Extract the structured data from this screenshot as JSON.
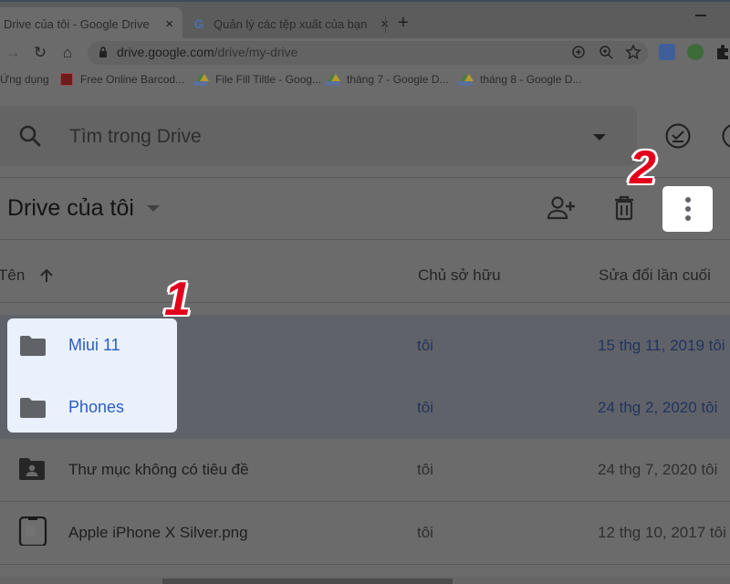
{
  "browser": {
    "tabs": [
      {
        "title": "Drive của tôi - Google Drive",
        "active": true,
        "close_glyph": "×"
      },
      {
        "title": "Quản lý các tệp xuất của bạn",
        "active": false,
        "favicon": "G",
        "close_glyph": "×"
      }
    ],
    "new_tab_glyph": "+",
    "url_host": "drive.google.com",
    "url_path": "/drive/my-drive",
    "nav_icons": {
      "forward": "→",
      "reload": "↻",
      "home": "⌂"
    },
    "omnibox_icons": [
      "install-icon",
      "zoom-icon",
      "bookmark-star-icon"
    ],
    "extensions": [
      "translate-icon",
      "idm-icon",
      "puzzle-extensions-icon"
    ],
    "bookmarks": [
      {
        "label": "Ứng dụng",
        "icon": "apps-icon"
      },
      {
        "label": "Free Online Barcod...",
        "icon": "barcode-favicon"
      },
      {
        "label": "File Fill Tiltle - Goog...",
        "icon": "drive-favicon"
      },
      {
        "label": "tháng 7 - Google D...",
        "icon": "drive-favicon"
      },
      {
        "label": "tháng 8 - Google D...",
        "icon": "drive-favicon"
      }
    ]
  },
  "drive": {
    "search": {
      "placeholder": "Tìm trong Drive",
      "value": ""
    },
    "title": "Drive của tôi",
    "actions": {
      "share": "add-person-icon",
      "delete": "trash-icon",
      "more": "more-vert-icon"
    },
    "columns": {
      "name": "Tên",
      "owner": "Chủ sở hữu",
      "modified": "Sửa đổi lần cuối"
    },
    "files": [
      {
        "name": "Miui 11",
        "type": "folder",
        "owner": "tôi",
        "modified": "15 thg 11, 2019 tôi",
        "selected": true
      },
      {
        "name": "Phones",
        "type": "folder",
        "owner": "tôi",
        "modified": "24 thg 2, 2020 tôi",
        "selected": true
      },
      {
        "name": "Thư mục không có tiêu đề",
        "type": "shared-folder",
        "owner": "tôi",
        "modified": "24 thg 7, 2020 tôi",
        "selected": false
      },
      {
        "name": "Apple iPhone X Silver.png",
        "type": "image",
        "owner": "tôi",
        "modified": "12 thg 10, 2017 tôi",
        "selected": false
      }
    ]
  },
  "annotations": {
    "step1": "1",
    "step2": "2",
    "accent_color": "#e3001b"
  },
  "colors": {
    "selection_text": "#2a5dc1",
    "highlight_bg": "#eaf1fd"
  }
}
